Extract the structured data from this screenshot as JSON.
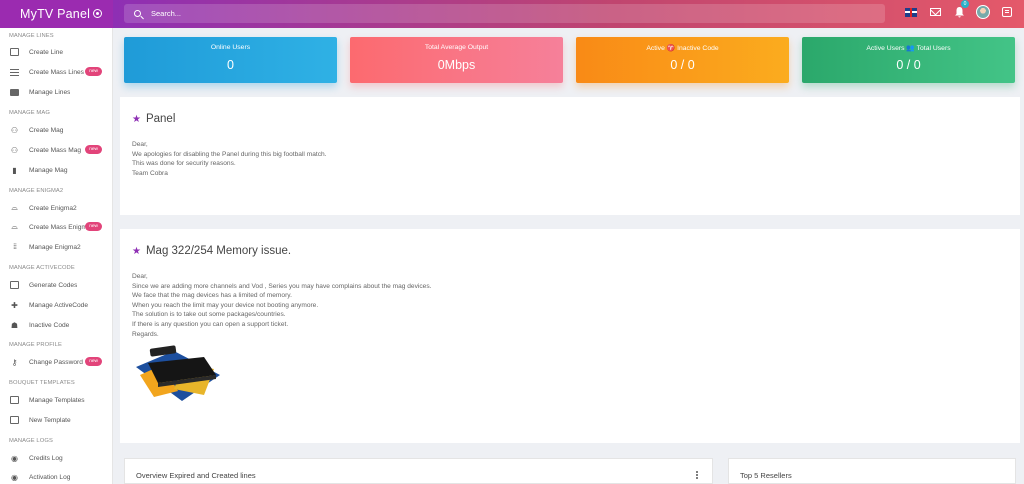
{
  "app": {
    "title": "MyTV Panel"
  },
  "search": {
    "placeholder": "Search..."
  },
  "topbar": {
    "notification_count": "0"
  },
  "sidebar": {
    "sections": [
      {
        "title": "MANAGE LINES"
      },
      {
        "title": "MANAGE MAG"
      },
      {
        "title": "MANAGE ENIGMA2"
      },
      {
        "title": "MANAGE ACTIVECODE"
      },
      {
        "title": "MANAGE PROFILE"
      },
      {
        "title": "BOUQUET TEMPLATES"
      },
      {
        "title": "MANAGE LOGS"
      }
    ],
    "items": [
      {
        "label": "Create Line"
      },
      {
        "label": "Create Mass Lines",
        "badge": "new"
      },
      {
        "label": "Manage Lines"
      },
      {
        "label": "Create Mag"
      },
      {
        "label": "Create Mass Mag",
        "badge": "new"
      },
      {
        "label": "Manage Mag"
      },
      {
        "label": "Create Enigma2"
      },
      {
        "label": "Create Mass Enigma2",
        "badge": "new"
      },
      {
        "label": "Manage Enigma2"
      },
      {
        "label": "Generate Codes"
      },
      {
        "label": "Manage ActiveCode"
      },
      {
        "label": "Inactive Code"
      },
      {
        "label": "Change Password",
        "badge": "new"
      },
      {
        "label": "Manage Templates"
      },
      {
        "label": "New Template"
      },
      {
        "label": "Credits Log"
      },
      {
        "label": "Activation Log"
      }
    ]
  },
  "stats": [
    {
      "title": "Online Users",
      "value": "0",
      "color": "#1f9bd8"
    },
    {
      "title": "Total Average Output",
      "value": "0Mbps",
      "color": "#fc6a6f"
    },
    {
      "title": "Active ♈ Inactive Code",
      "value": "0 / 0",
      "color": "#f98a16"
    },
    {
      "title": "Active Users 👥 Total Users",
      "value": "0 / 0",
      "color": "#2ba86b"
    }
  ],
  "announcements": [
    {
      "title": "Panel",
      "lines": [
        "Dear,",
        "We apologies for disabling the Panel during this big football match.",
        "This was done for security reasons.",
        "Team Cobra"
      ]
    },
    {
      "title": "Mag 322/254 Memory issue.",
      "lines": [
        "Dear,",
        "Since we are adding more channels and Vod , Series you may have complains about the mag devices.",
        "We face that the mag devices has a limited of memory.",
        "When you reach the limit may your device not booting anymore.",
        "The solution is to take out some packages/countries.",
        "If there is any question you can open a support ticket.",
        "Regards."
      ]
    }
  ],
  "cards": {
    "overview_title": "Overview Expired and Created lines",
    "resellers_title": "Top 5 Resellers"
  },
  "colors": {
    "brand": "#9b2bb0",
    "accent_badge": "#e2447a"
  }
}
